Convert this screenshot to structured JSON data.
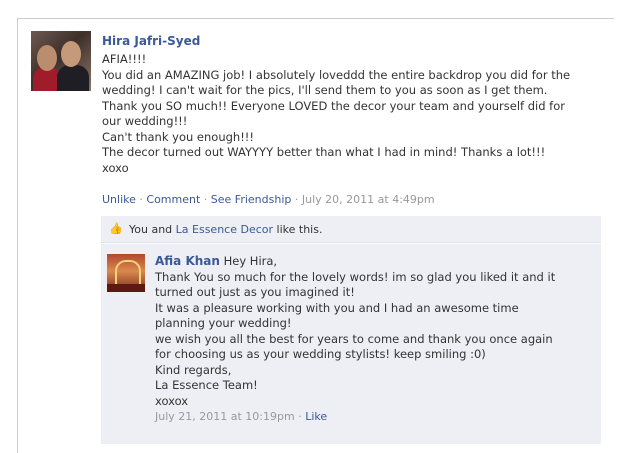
{
  "post": {
    "author": "Hira Jafri-Syed",
    "lines": [
      "AFIA!!!!",
      "You did an AMAZING job! I absolutely loveddd the entire backdrop you did for the",
      "wedding! I can't wait for the pics, I'll send them to you as soon as I get them.",
      "Thank you SO much!! Everyone LOVED the decor your team and yourself did for",
      "our wedding!!!",
      "Can't thank you enough!!!",
      "The decor turned out WAYYYY better than what I had in mind! Thanks a lot!!!",
      "xoxo"
    ],
    "actions": {
      "unlike": "Unlike",
      "comment": "Comment",
      "see_friendship": "See Friendship",
      "timestamp": "July 20, 2011 at 4:49pm"
    }
  },
  "likes": {
    "you_and": "You and ",
    "page_link": "La Essence Decor",
    "suffix": " like this."
  },
  "comment": {
    "author": "Afia Khan",
    "first_line": "Hey Hira,",
    "lines": [
      "Thank You so much for the lovely words! im so glad you liked it and it",
      "turned out just as you imagined it!",
      "It was a pleasure working with you and I had an awesome time",
      "planning your wedding!",
      "we wish you all the best for years to come and thank you once again",
      "for choosing us as your wedding stylists! keep smiling :0)",
      "Kind regards,",
      "La Essence Team!",
      "xoxox"
    ],
    "timestamp": "July 21, 2011 at 10:19pm",
    "like": "Like"
  },
  "icons": {
    "thumbs_up": "thumbs-up-icon"
  },
  "colors": {
    "link": "#3b5998",
    "meta": "#999999",
    "comment_bg": "#edeff4"
  }
}
